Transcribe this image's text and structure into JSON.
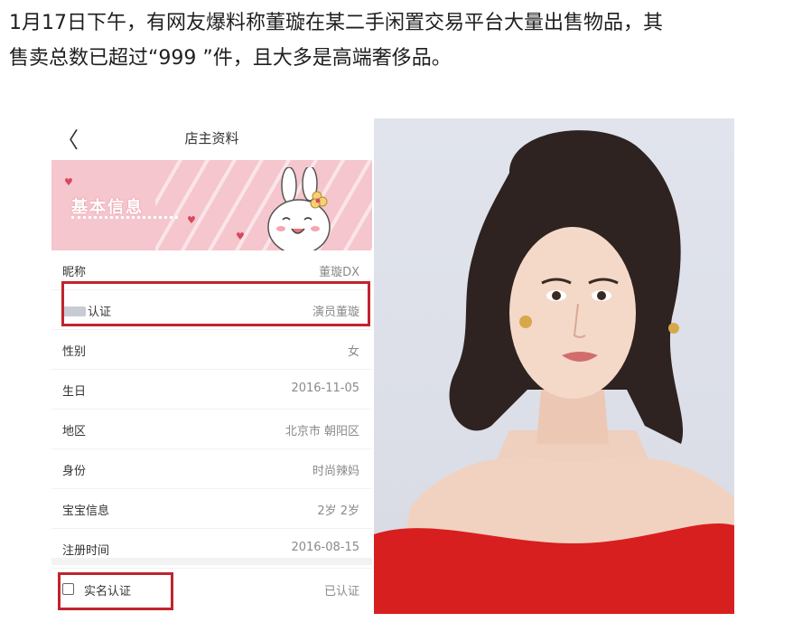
{
  "caption": {
    "line1": "1月17日下午，有网友爆料称董璇在某二手闲置交易平台大量出售物品，其",
    "line2": "售卖总数已超过“999 ”件，且大多是高端奢侈品。"
  },
  "profile": {
    "back_glyph": "〈",
    "title": "店主资料",
    "banner_title": "基本信息",
    "rows": [
      {
        "label": "昵称",
        "value": "董璇DX"
      },
      {
        "label": "认证",
        "value": "演员董璇"
      },
      {
        "label": "性别",
        "value": "女"
      },
      {
        "label": "生日",
        "value": "2016-11-05"
      },
      {
        "label": "地区",
        "value": "北京市 朝阳区"
      },
      {
        "label": "身份",
        "value": "时尚辣妈"
      },
      {
        "label": "宝宝信息",
        "value": "2岁  2岁"
      },
      {
        "label": "注册时间",
        "value": "2016-08-15"
      }
    ],
    "verification": {
      "label": "实名认证",
      "value": "已认证"
    }
  },
  "colors": {
    "highlight_box": "#c0242e",
    "banner_pink": "#f5c6cd",
    "dress_red": "#d81f1f"
  }
}
